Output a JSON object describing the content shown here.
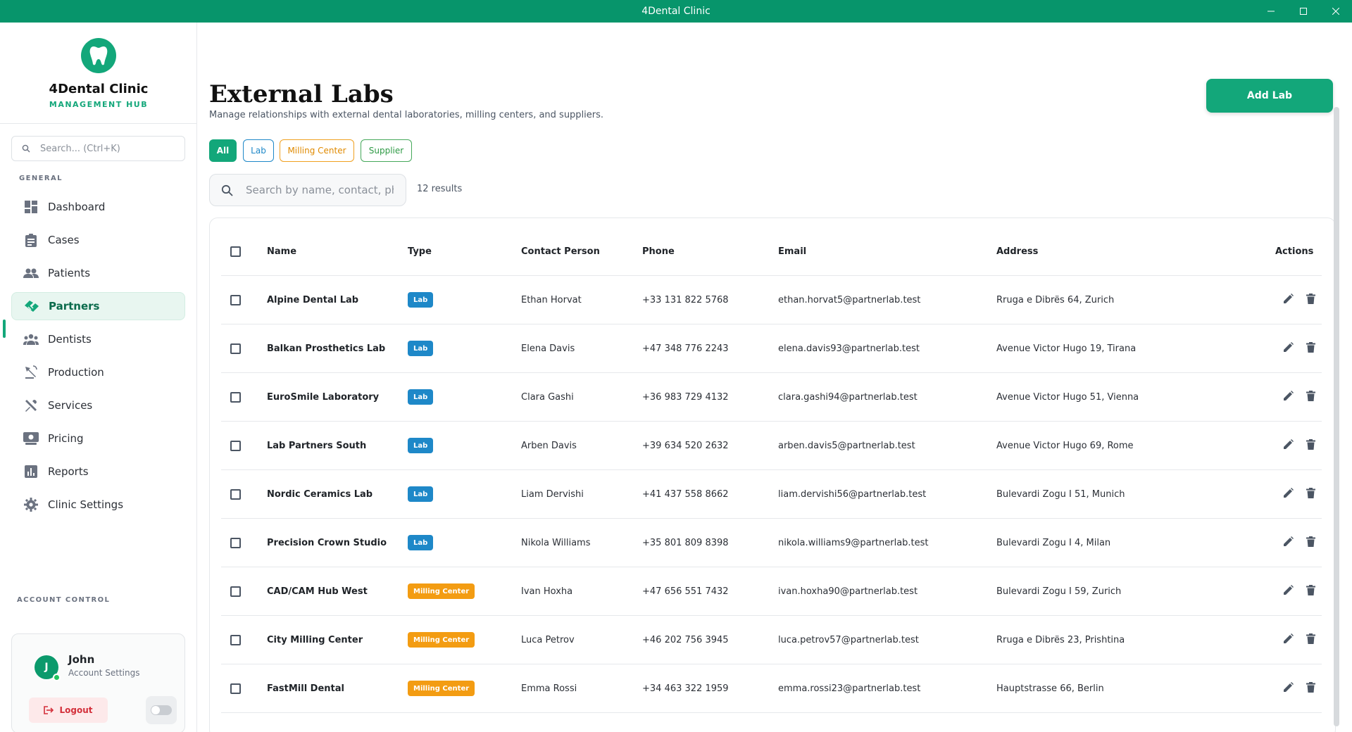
{
  "window": {
    "title": "4Dental Clinic"
  },
  "brand": {
    "name": "4Dental Clinic",
    "subtitle": "MANAGEMENT HUB"
  },
  "sidebar": {
    "search_placeholder": "Search... (Ctrl+K)",
    "section_general": "GENERAL",
    "items": [
      {
        "label": "Dashboard",
        "icon": "dashboard-icon"
      },
      {
        "label": "Cases",
        "icon": "clipboard-icon"
      },
      {
        "label": "Patients",
        "icon": "people-icon"
      },
      {
        "label": "Partners",
        "icon": "handshake-icon",
        "active": true
      },
      {
        "label": "Dentists",
        "icon": "group-icon"
      },
      {
        "label": "Production",
        "icon": "precision-tool-icon"
      },
      {
        "label": "Services",
        "icon": "tools-icon"
      },
      {
        "label": "Pricing",
        "icon": "pricing-icon"
      },
      {
        "label": "Reports",
        "icon": "bar-chart-icon"
      },
      {
        "label": "Clinic Settings",
        "icon": "gear-icon"
      }
    ],
    "section_account": "ACCOUNT CONTROL",
    "account": {
      "initial": "J",
      "name": "John",
      "subtitle": "Account Settings",
      "logout_label": "Logout"
    }
  },
  "page": {
    "title": "External Labs",
    "description": "Manage relationships with external dental laboratories, milling centers, and suppliers.",
    "add_button": "Add Lab",
    "filters": [
      {
        "label": "All",
        "active": true
      },
      {
        "label": "Lab"
      },
      {
        "label": "Milling Center"
      },
      {
        "label": "Supplier"
      }
    ],
    "search_placeholder": "Search by name, contact, phone...",
    "results": "12 results"
  },
  "colors": {
    "primary": "#13a77a",
    "titlebar": "#07956b",
    "lab_badge": "#1e88c8",
    "milling_badge": "#f39c12",
    "danger": "#d32f3a"
  },
  "table": {
    "columns": [
      "Name",
      "Type",
      "Contact Person",
      "Phone",
      "Email",
      "Address",
      "Actions"
    ],
    "rows": [
      {
        "name": "Alpine Dental Lab",
        "type": "Lab",
        "contact": "Ethan Horvat",
        "phone": "+33 131 822 5768",
        "email": "ethan.horvat5@partnerlab.test",
        "address": "Rruga e Dibrës 64, Zurich"
      },
      {
        "name": "Balkan Prosthetics Lab",
        "type": "Lab",
        "contact": "Elena Davis",
        "phone": "+47 348 776 2243",
        "email": "elena.davis93@partnerlab.test",
        "address": "Avenue Victor Hugo 19, Tirana"
      },
      {
        "name": "EuroSmile Laboratory",
        "type": "Lab",
        "contact": "Clara Gashi",
        "phone": "+36 983 729 4132",
        "email": "clara.gashi94@partnerlab.test",
        "address": "Avenue Victor Hugo 51, Vienna"
      },
      {
        "name": "Lab Partners South",
        "type": "Lab",
        "contact": "Arben Davis",
        "phone": "+39 634 520 2632",
        "email": "arben.davis5@partnerlab.test",
        "address": "Avenue Victor Hugo 69, Rome"
      },
      {
        "name": "Nordic Ceramics Lab",
        "type": "Lab",
        "contact": "Liam Dervishi",
        "phone": "+41 437 558 8662",
        "email": "liam.dervishi56@partnerlab.test",
        "address": "Bulevardi Zogu I 51, Munich"
      },
      {
        "name": "Precision Crown Studio",
        "type": "Lab",
        "contact": "Nikola Williams",
        "phone": "+35 801 809 8398",
        "email": "nikola.williams9@partnerlab.test",
        "address": "Bulevardi Zogu I 4, Milan"
      },
      {
        "name": "CAD/CAM Hub West",
        "type": "Milling Center",
        "contact": "Ivan Hoxha",
        "phone": "+47 656 551 7432",
        "email": "ivan.hoxha90@partnerlab.test",
        "address": "Bulevardi Zogu I 59, Zurich"
      },
      {
        "name": "City Milling Center",
        "type": "Milling Center",
        "contact": "Luca Petrov",
        "phone": "+46 202 756 3945",
        "email": "luca.petrov57@partnerlab.test",
        "address": "Rruga e Dibrës 23, Prishtina"
      },
      {
        "name": "FastMill Dental",
        "type": "Milling Center",
        "contact": "Emma Rossi",
        "phone": "+34 463 322 1959",
        "email": "emma.rossi23@partnerlab.test",
        "address": "Hauptstrasse 66, Berlin"
      }
    ]
  }
}
